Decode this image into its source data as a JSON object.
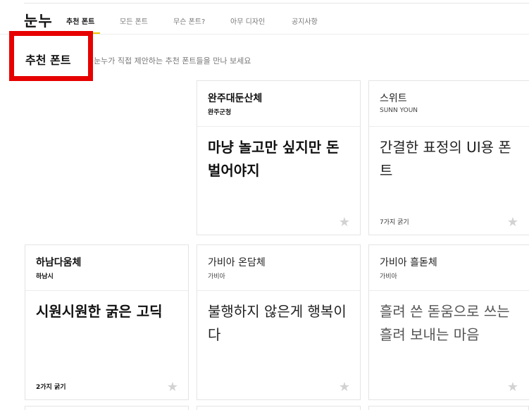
{
  "navbar": {
    "logo": "눈누",
    "items": [
      {
        "label": "추천 폰트",
        "active": true
      },
      {
        "label": "모든 폰트",
        "active": false
      },
      {
        "label": "무슨 폰트?",
        "active": false
      },
      {
        "label": "아무 디자인",
        "active": false
      },
      {
        "label": "공지사항",
        "active": false
      }
    ],
    "accent_color": "#f0c400"
  },
  "section": {
    "title": "추천 폰트",
    "description": "눈누가 직접 제안하는 추천 폰트들을 만나 보세요",
    "highlight_color": "#e60000"
  },
  "cards": [
    {
      "name": "완주대둔산체",
      "maker": "완주군청",
      "sample": "마냥 놀고만 싶지만 돈벌어야지",
      "weights": "",
      "star": "★"
    },
    {
      "name": "스위트",
      "maker": "SUNN YOUN",
      "sample": "간결한 표정의 UI용 폰트",
      "weights": "7가지 굵기",
      "star": "★"
    },
    {
      "name": "하남다움체",
      "maker": "하남시",
      "sample": "시원시원한 굵은 고딕",
      "weights": "2가지 굵기",
      "star": "★"
    },
    {
      "name": "가비아 온담체",
      "maker": "가비아",
      "sample": "불행하지 않은게 행복이다",
      "weights": "",
      "star": "★"
    },
    {
      "name": "가비아 흘돋체",
      "maker": "가비아",
      "sample": "흘려 쓴 돋움으로 쓰는 흘려 보내는 마음",
      "weights": "",
      "star": "★"
    }
  ]
}
